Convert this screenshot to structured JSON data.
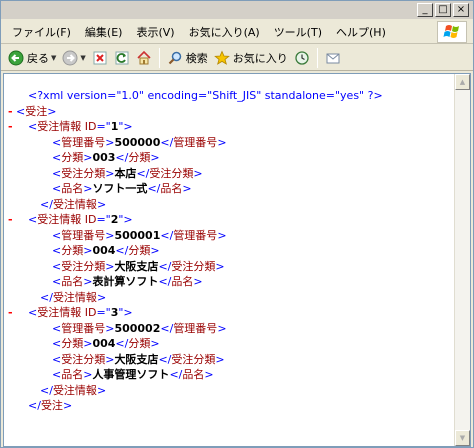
{
  "window": {
    "title_buttons": [
      "_",
      "□",
      "×"
    ]
  },
  "menu": {
    "items": [
      "ファイル(F)",
      "編集(E)",
      "表示(V)",
      "お気に入り(A)",
      "ツール(T)",
      "ヘルプ(H)"
    ]
  },
  "toolbar": {
    "back_label": "戻る",
    "search_label": "検索",
    "favorites_label": "お気に入り"
  },
  "xml": {
    "declaration": "<?xml version=\"1.0\" encoding=\"Shift_JIS\" standalone=\"yes\" ?>",
    "root_tag": "受注",
    "record_tag": "受注情報",
    "attr_name": "ID",
    "field_tags": {
      "mgmt": "管理番号",
      "cat": "分類",
      "dept": "受注分類",
      "name": "品名"
    },
    "records": [
      {
        "id": "1",
        "mgmt": "500000",
        "cat": "003",
        "dept": "本店",
        "name": "ソフト一式"
      },
      {
        "id": "2",
        "mgmt": "500001",
        "cat": "004",
        "dept": "大阪支店",
        "name": "表計算ソフト"
      },
      {
        "id": "3",
        "mgmt": "500002",
        "cat": "004",
        "dept": "大阪支店",
        "name": "人事管理ソフト"
      }
    ]
  },
  "colors": {
    "bracket": "#0000ff",
    "tag_name": "#990000",
    "collapse_minus": "#ff0000",
    "toolbar_bg": "#ece9d8"
  }
}
